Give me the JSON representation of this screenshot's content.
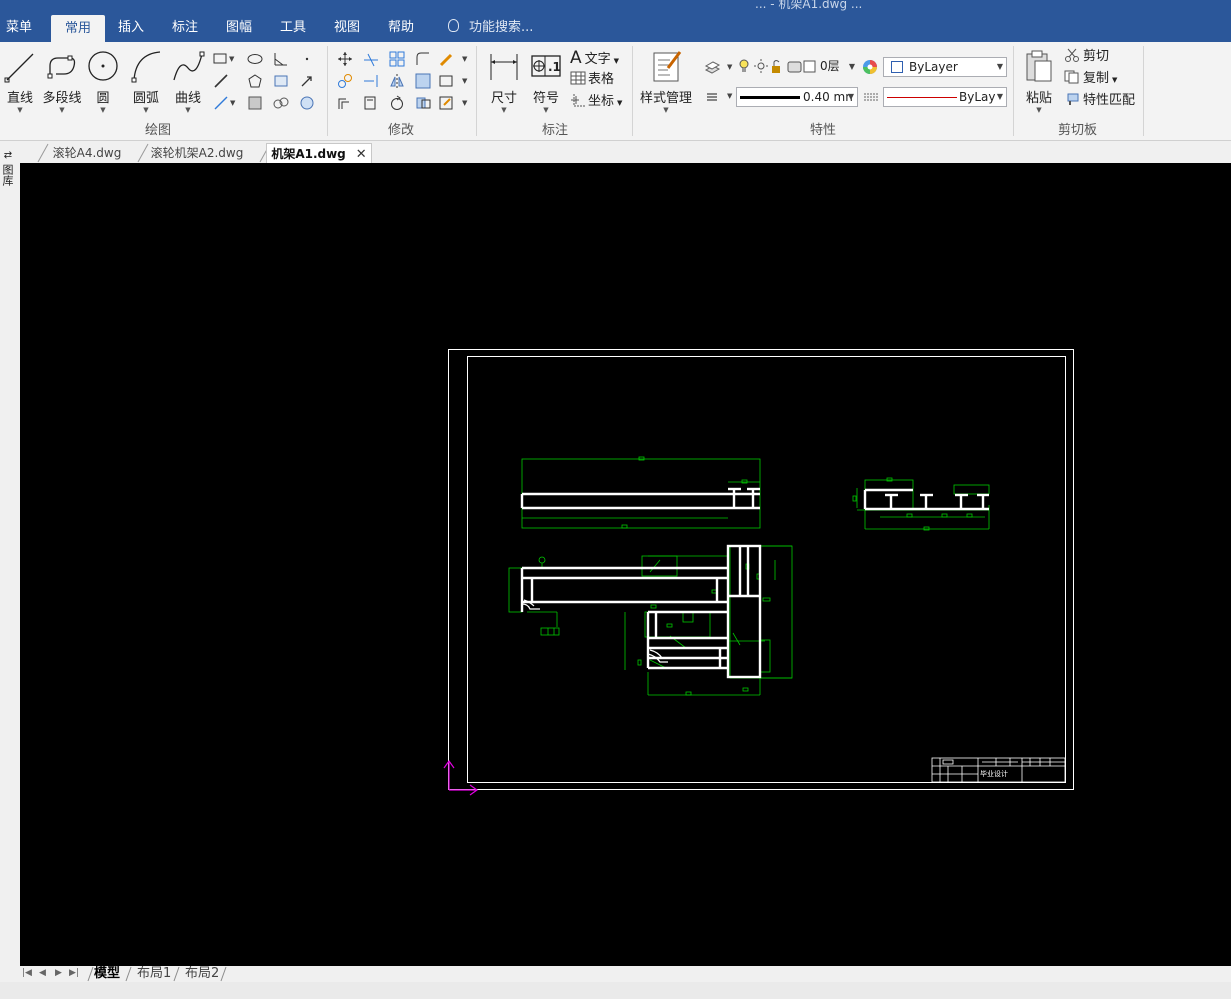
{
  "app": {
    "title": "... - 机架A1.dwg ..."
  },
  "menu": {
    "items": [
      "菜单",
      "常用",
      "插入",
      "标注",
      "图幅",
      "工具",
      "视图",
      "帮助"
    ],
    "active": "常用",
    "search_placeholder": "功能搜索..."
  },
  "ribbon": {
    "draw": {
      "label": "绘图",
      "line": "直线",
      "polyline": "多段线",
      "circle": "圆",
      "arc": "圆弧",
      "curve": "曲线"
    },
    "modify": {
      "label": "修改"
    },
    "annotation": {
      "label": "标注",
      "dimension": "尺寸",
      "symbol": "符号",
      "text": "文字",
      "table": "表格",
      "coordinate": "坐标"
    },
    "properties": {
      "label": "特性",
      "style_manager": "样式管理",
      "layer": "0层",
      "color": "ByLayer",
      "lineweight": "0.40 mn",
      "linetype": "ByLaye"
    },
    "clipboard": {
      "label": "剪切板",
      "paste": "粘贴",
      "cut": "剪切",
      "copy": "复制",
      "match": "特性匹配"
    }
  },
  "file_tabs": [
    {
      "name": "滚轮A4.dwg",
      "active": false
    },
    {
      "name": "滚轮机架A2.dwg",
      "active": false
    },
    {
      "name": "机架A1.dwg",
      "active": true
    }
  ],
  "sidebar": {
    "label": "图库"
  },
  "drawing": {
    "title_block_text": "毕业设计"
  },
  "layout_tabs": {
    "items": [
      "模型",
      "布局1",
      "布局2"
    ],
    "active": "模型"
  },
  "colors": {
    "ribbon_blue": "#2b579a",
    "canvas": "#000000",
    "geometry": "#ffffff",
    "dimension": "#00c800",
    "ucs": "#e000e0"
  }
}
